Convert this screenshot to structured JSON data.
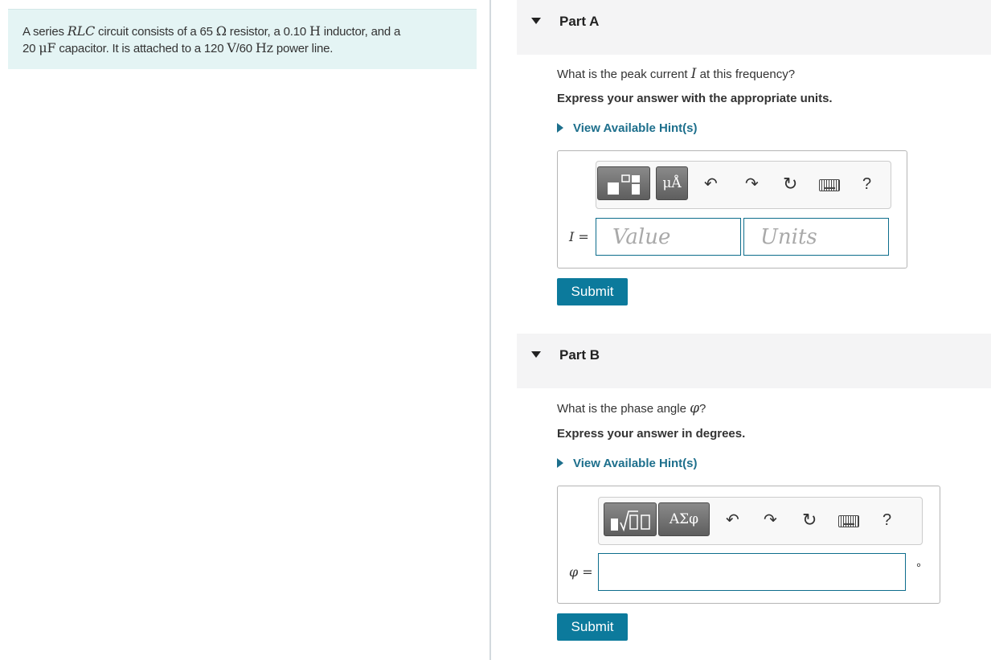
{
  "problem": {
    "text_1": "A series ",
    "rlc": "RLC",
    "text_2": " circuit consists of a 65 ",
    "ohm": "Ω",
    "text_3": " resistor, a 0.10 ",
    "henry": "H",
    "text_4": " inductor, and a",
    "text_5": "20 ",
    "microfarad": "μF",
    "text_6": " capacitor. It is attached to a 120 ",
    "volts": "V",
    "text_7": "/60 ",
    "hertz": "Hz",
    "text_8": " power line."
  },
  "partA": {
    "title": "Part A",
    "question_1": "What is the peak current ",
    "question_var": "I",
    "question_2": " at this frequency?",
    "instruction": "Express your answer with the appropriate units.",
    "hint": "View Available Hint(s)",
    "toolbar": {
      "units_btn": "μÅ",
      "help": "?"
    },
    "input_label": "I =",
    "value_placeholder": "Value",
    "units_placeholder": "Units",
    "submit": "Submit"
  },
  "partB": {
    "title": "Part B",
    "question_1": "What is the phase angle ",
    "question_var": "φ",
    "question_2": "?",
    "instruction": "Express your answer in degrees.",
    "hint": "View Available Hint(s)",
    "toolbar": {
      "greek_btn": "ΑΣφ",
      "help": "?"
    },
    "input_label": "φ =",
    "input_value": "",
    "unit_symbol": "°",
    "submit": "Submit"
  },
  "colors": {
    "accent": "#0c7a9c",
    "link": "#1d6f8c",
    "problem_bg": "#e4f4f4",
    "header_bg": "#f4f4f5"
  },
  "icons": [
    "undo-icon",
    "redo-icon",
    "reset-icon",
    "keyboard-icon",
    "help-icon",
    "template-icon",
    "sqrt-template-icon"
  ]
}
